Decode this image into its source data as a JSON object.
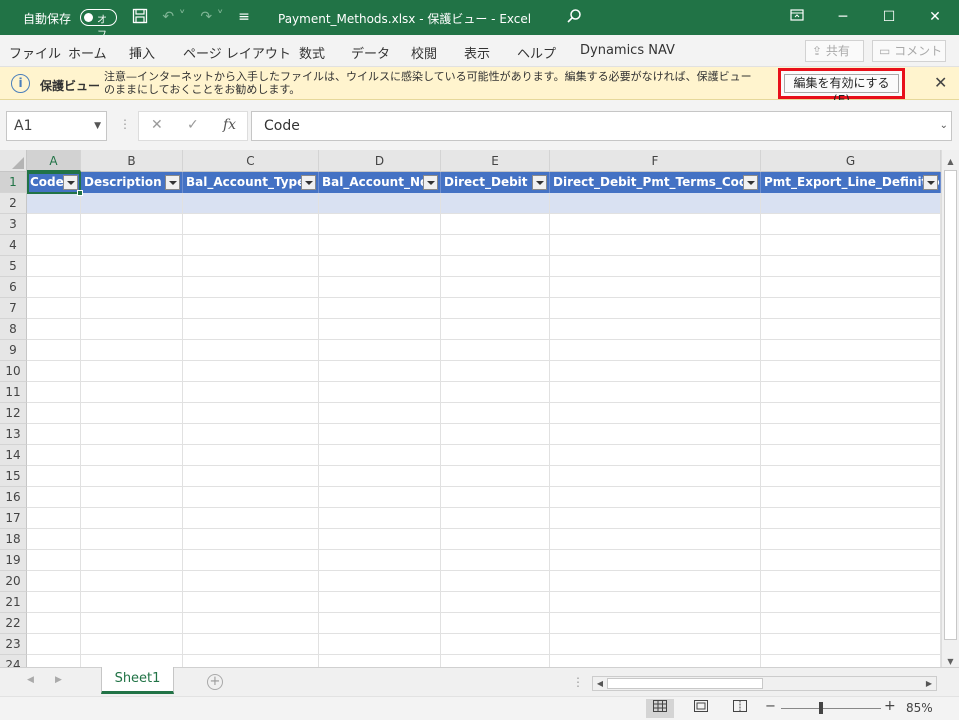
{
  "titlebar": {
    "autosave_label": "自動保存",
    "autosave_toggle": "オフ",
    "title": "Payment_Methods.xlsx  -  保護ビュー  -  Excel"
  },
  "ribbon": {
    "tabs": [
      "ファイル",
      "ホーム",
      "挿入",
      "ページ レイアウト",
      "数式",
      "データ",
      "校閲",
      "表示",
      "ヘルプ",
      "Dynamics NAV"
    ],
    "share_label": "共有",
    "comment_label": "コメント"
  },
  "protected_view": {
    "label": "保護ビュー",
    "message": "注意—インターネットから入手したファイルは、ウイルスに感染している可能性があります。編集する必要がなければ、保護ビューのままにしておくことをお勧めします。",
    "enable_button": "編集を有効にする(E)"
  },
  "formula_bar": {
    "name_box": "A1",
    "fx": "fx",
    "value": "Code"
  },
  "columns": [
    "A",
    "B",
    "C",
    "D",
    "E",
    "F",
    "G"
  ],
  "header_row": [
    "Code",
    "Description",
    "Bal_Account_Type",
    "Bal_Account_No",
    "Direct_Debit",
    "Direct_Debit_Pmt_Terms_Code",
    "Pmt_Export_Line_Definition"
  ],
  "rows": [
    "1",
    "2",
    "3",
    "4",
    "5",
    "6",
    "7",
    "8",
    "9",
    "10",
    "11",
    "12",
    "13",
    "14",
    "15",
    "16",
    "17",
    "18",
    "19",
    "20",
    "21",
    "22",
    "23",
    "24"
  ],
  "sheet_tab": "Sheet1",
  "status": {
    "zoom": "85%"
  }
}
